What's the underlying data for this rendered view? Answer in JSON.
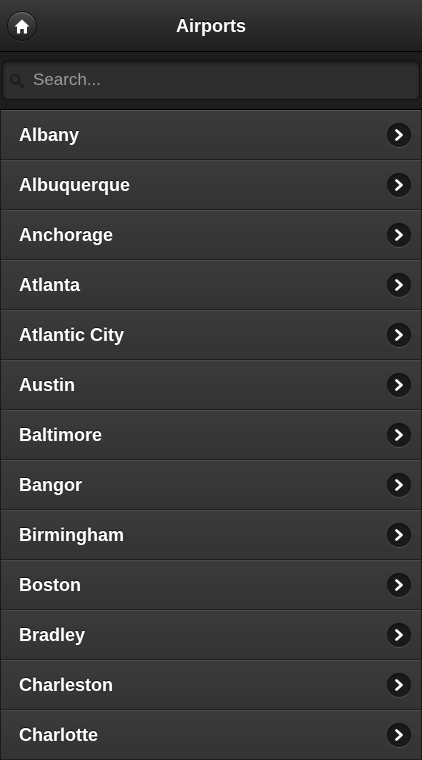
{
  "header": {
    "title": "Airports",
    "home_icon": "home-icon"
  },
  "search": {
    "placeholder": "Search...",
    "value": "",
    "icon": "search-icon"
  },
  "airports": [
    {
      "label": "Albany"
    },
    {
      "label": "Albuquerque"
    },
    {
      "label": "Anchorage"
    },
    {
      "label": "Atlanta"
    },
    {
      "label": "Atlantic City"
    },
    {
      "label": "Austin"
    },
    {
      "label": "Baltimore"
    },
    {
      "label": "Bangor"
    },
    {
      "label": "Birmingham"
    },
    {
      "label": "Boston"
    },
    {
      "label": "Bradley"
    },
    {
      "label": "Charleston"
    },
    {
      "label": "Charlotte"
    }
  ],
  "row_icon": "chevron-right-icon",
  "colors": {
    "background": "#1b1b1b",
    "row": "#363636",
    "text": "#ffffff",
    "placeholder": "#9a9a9a"
  }
}
